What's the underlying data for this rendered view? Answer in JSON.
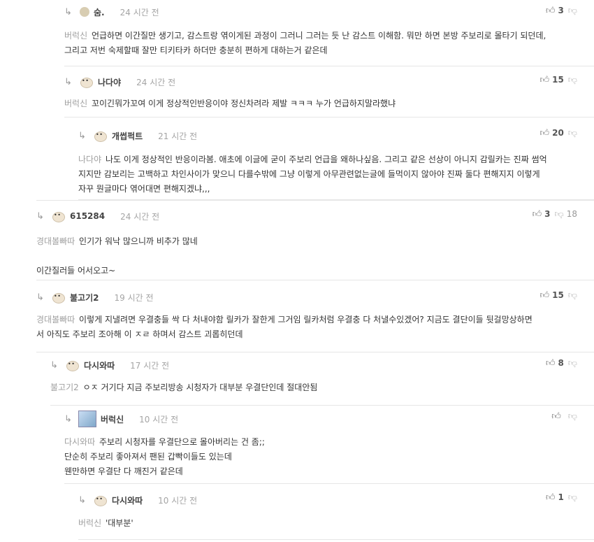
{
  "comments": [
    {
      "nick": "숨.",
      "time": "24 시간 전",
      "up": "3",
      "down": "",
      "mention": "버럭신",
      "lines": [
        "언급하면 이간질만 생기고, 감스트랑 엮이게된 과정이 그러니 그러는 듯 난 감스트 이해함. 뭐만 하면 본방 주보리로 몰타기 되던데,",
        "그리고 저번 숙제할때 잘만 티키타카 하더만 충분히 편하게 대하는거 같은데"
      ]
    },
    {
      "nick": "나다야",
      "time": "24 시간 전",
      "up": "15",
      "down": "",
      "mention": "버럭신",
      "lines": [
        "꼬이긴뭐가꼬여 이게 정상적인반응이야 정신차려라 제발 ㅋㅋㅋ 누가 언급하지말라했냐"
      ]
    },
    {
      "nick": "개썹퍽트",
      "time": "21 시간 전",
      "up": "20",
      "down": "",
      "mention": "나다야",
      "lines": [
        "나도 이게 정상적인 반응이라봄. 애초에 이글에 굳이 주보리 언급을 왜하나싶음. 그리고 같은 선상이 아니지 감릴카는 진짜 썸억",
        "지지만 감보리는 고백하고 차인사이가 맞으니 다를수밖에 그냥 이렇게 아무관련없는글에 들먹이지 않아야 진짜 둘다 편해지지 이렇게",
        "자꾸 뭔글마다 엮어대면 편해지겠냐,,,"
      ]
    },
    {
      "nick": "615284",
      "time": "24 시간 전",
      "up": "3",
      "down": "18",
      "mention": "경대볼빠따",
      "lines": [
        "인기가 워낙 많으니까 비추가 많네",
        "",
        "이간질러들 어서오고~"
      ]
    },
    {
      "nick": "불고기2",
      "time": "19 시간 전",
      "up": "15",
      "down": "",
      "mention": "경대볼빠따",
      "lines": [
        "이렇게 지낼려면 우결충들 싹 다 처내야함 릴카가 잘한게 그거임 릴카처럼 우결충 다 처낼수있겠어? 지금도 결단이들 뒷걸망상하면",
        "서 아직도 주보리 조아해 이 ㅈㄹ 하며서 감스트 괴롭히던데"
      ]
    },
    {
      "nick": "다시와따",
      "time": "17 시간 전",
      "up": "8",
      "down": "",
      "mention": "불고기2",
      "lines": [
        "ㅇㅈ 거기다 지금 주보리방송 시청자가 대부분 우결단인데 절대안됨"
      ]
    },
    {
      "nick": "버럭신",
      "time": "10 시간 전",
      "up": "",
      "down": "",
      "mention": "다시와따",
      "lines": [
        "주보리 시청자를 우결단으로 몰아버리는 건 좀;;",
        "단순히 주보리 좋아져서 팬된 갑빡이들도 있는데",
        "웬만하면 우결단 다 깨진거 같은데"
      ]
    },
    {
      "nick": "다시와따",
      "time": "10 시간 전",
      "up": "1",
      "down": "",
      "mention": "버럭신",
      "lines": [
        "'대부분'"
      ]
    }
  ],
  "icons": {
    "reply": "reply-arrow-icon",
    "up": "thumbs-up-icon",
    "down": "thumbs-down-icon"
  }
}
